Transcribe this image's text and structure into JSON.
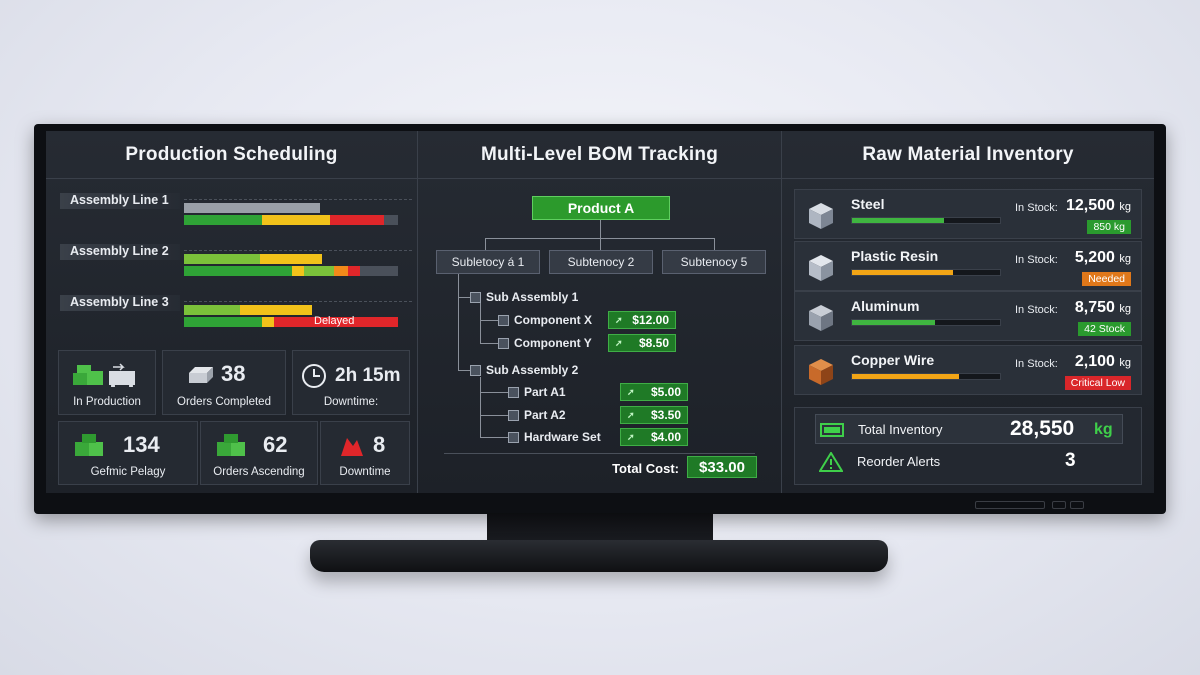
{
  "production": {
    "title": "Production Scheduling",
    "lines": [
      {
        "label": "Assembly Line 1",
        "status": ""
      },
      {
        "label": "Assembly Line 2",
        "status": ""
      },
      {
        "label": "Assembly Line 3",
        "status": "Delayed"
      }
    ],
    "tiles": [
      {
        "value": "",
        "label": "In Production",
        "icon": "production-icon"
      },
      {
        "value": "38",
        "label": "Orders Completed",
        "icon": "orders-icon"
      },
      {
        "value": "2h 15m",
        "label": "Downtime:",
        "icon": "clock-icon"
      },
      {
        "value": "134",
        "label": "Gefmic Pelagy",
        "icon": "boxes-icon"
      },
      {
        "value": "62",
        "label": "Orders Ascending",
        "icon": "boxes-icon"
      },
      {
        "value": "8",
        "label": "Downtime",
        "icon": "alert-icon"
      }
    ]
  },
  "bom": {
    "title": "Multi-Level BOM Tracking",
    "product": "Product A",
    "subs": [
      "Subletocy á 1",
      "Subtenocy 2",
      "Subtenocy 5"
    ],
    "tree": [
      {
        "label": "Sub Assembly 1",
        "price": ""
      },
      {
        "label": "Component X",
        "price": "$12.00"
      },
      {
        "label": "Component Y",
        "price": "$8.50"
      },
      {
        "label": "Sub Assembly 2",
        "price": ""
      },
      {
        "label": "Part A1",
        "price": "$5.00"
      },
      {
        "label": "Part A2",
        "price": "$3.50"
      },
      {
        "label": "Hardware Set",
        "price": "$4.00"
      }
    ],
    "total_label": "Total Cost:",
    "total_value": "$33.00"
  },
  "inventory": {
    "title": "Raw Material Inventory",
    "stock_label": "In Stock:",
    "materials": [
      {
        "name": "Steel",
        "amount": "12,500",
        "unit": "kg",
        "badge": "850 kg",
        "badge_color": "#2a9a2e",
        "bar_color": "#3fb540",
        "level": 0.62,
        "icon": "steel-crate-icon"
      },
      {
        "name": "Plastic Resin",
        "amount": "5,200",
        "unit": "kg",
        "badge": "Needed",
        "badge_color": "#e0781a",
        "bar_color": "#f2a516",
        "level": 0.68,
        "icon": "resin-crate-icon"
      },
      {
        "name": "Aluminum",
        "amount": "8,750",
        "unit": "kg",
        "badge": "42 Stock",
        "badge_color": "#2a9a2e",
        "bar_color": "#3fb540",
        "level": 0.56,
        "icon": "aluminum-crate-icon"
      },
      {
        "name": "Copper Wire",
        "amount": "2,100",
        "unit": "kg",
        "badge": "Critical Low",
        "badge_color": "#d9262a",
        "bar_color": "#f2a516",
        "level": 0.72,
        "icon": "copper-crate-icon"
      }
    ],
    "total_label": "Total Inventory",
    "total_value": "28,550",
    "total_unit": "kg",
    "alerts_label": "Reorder Alerts",
    "alerts_value": "3"
  }
}
